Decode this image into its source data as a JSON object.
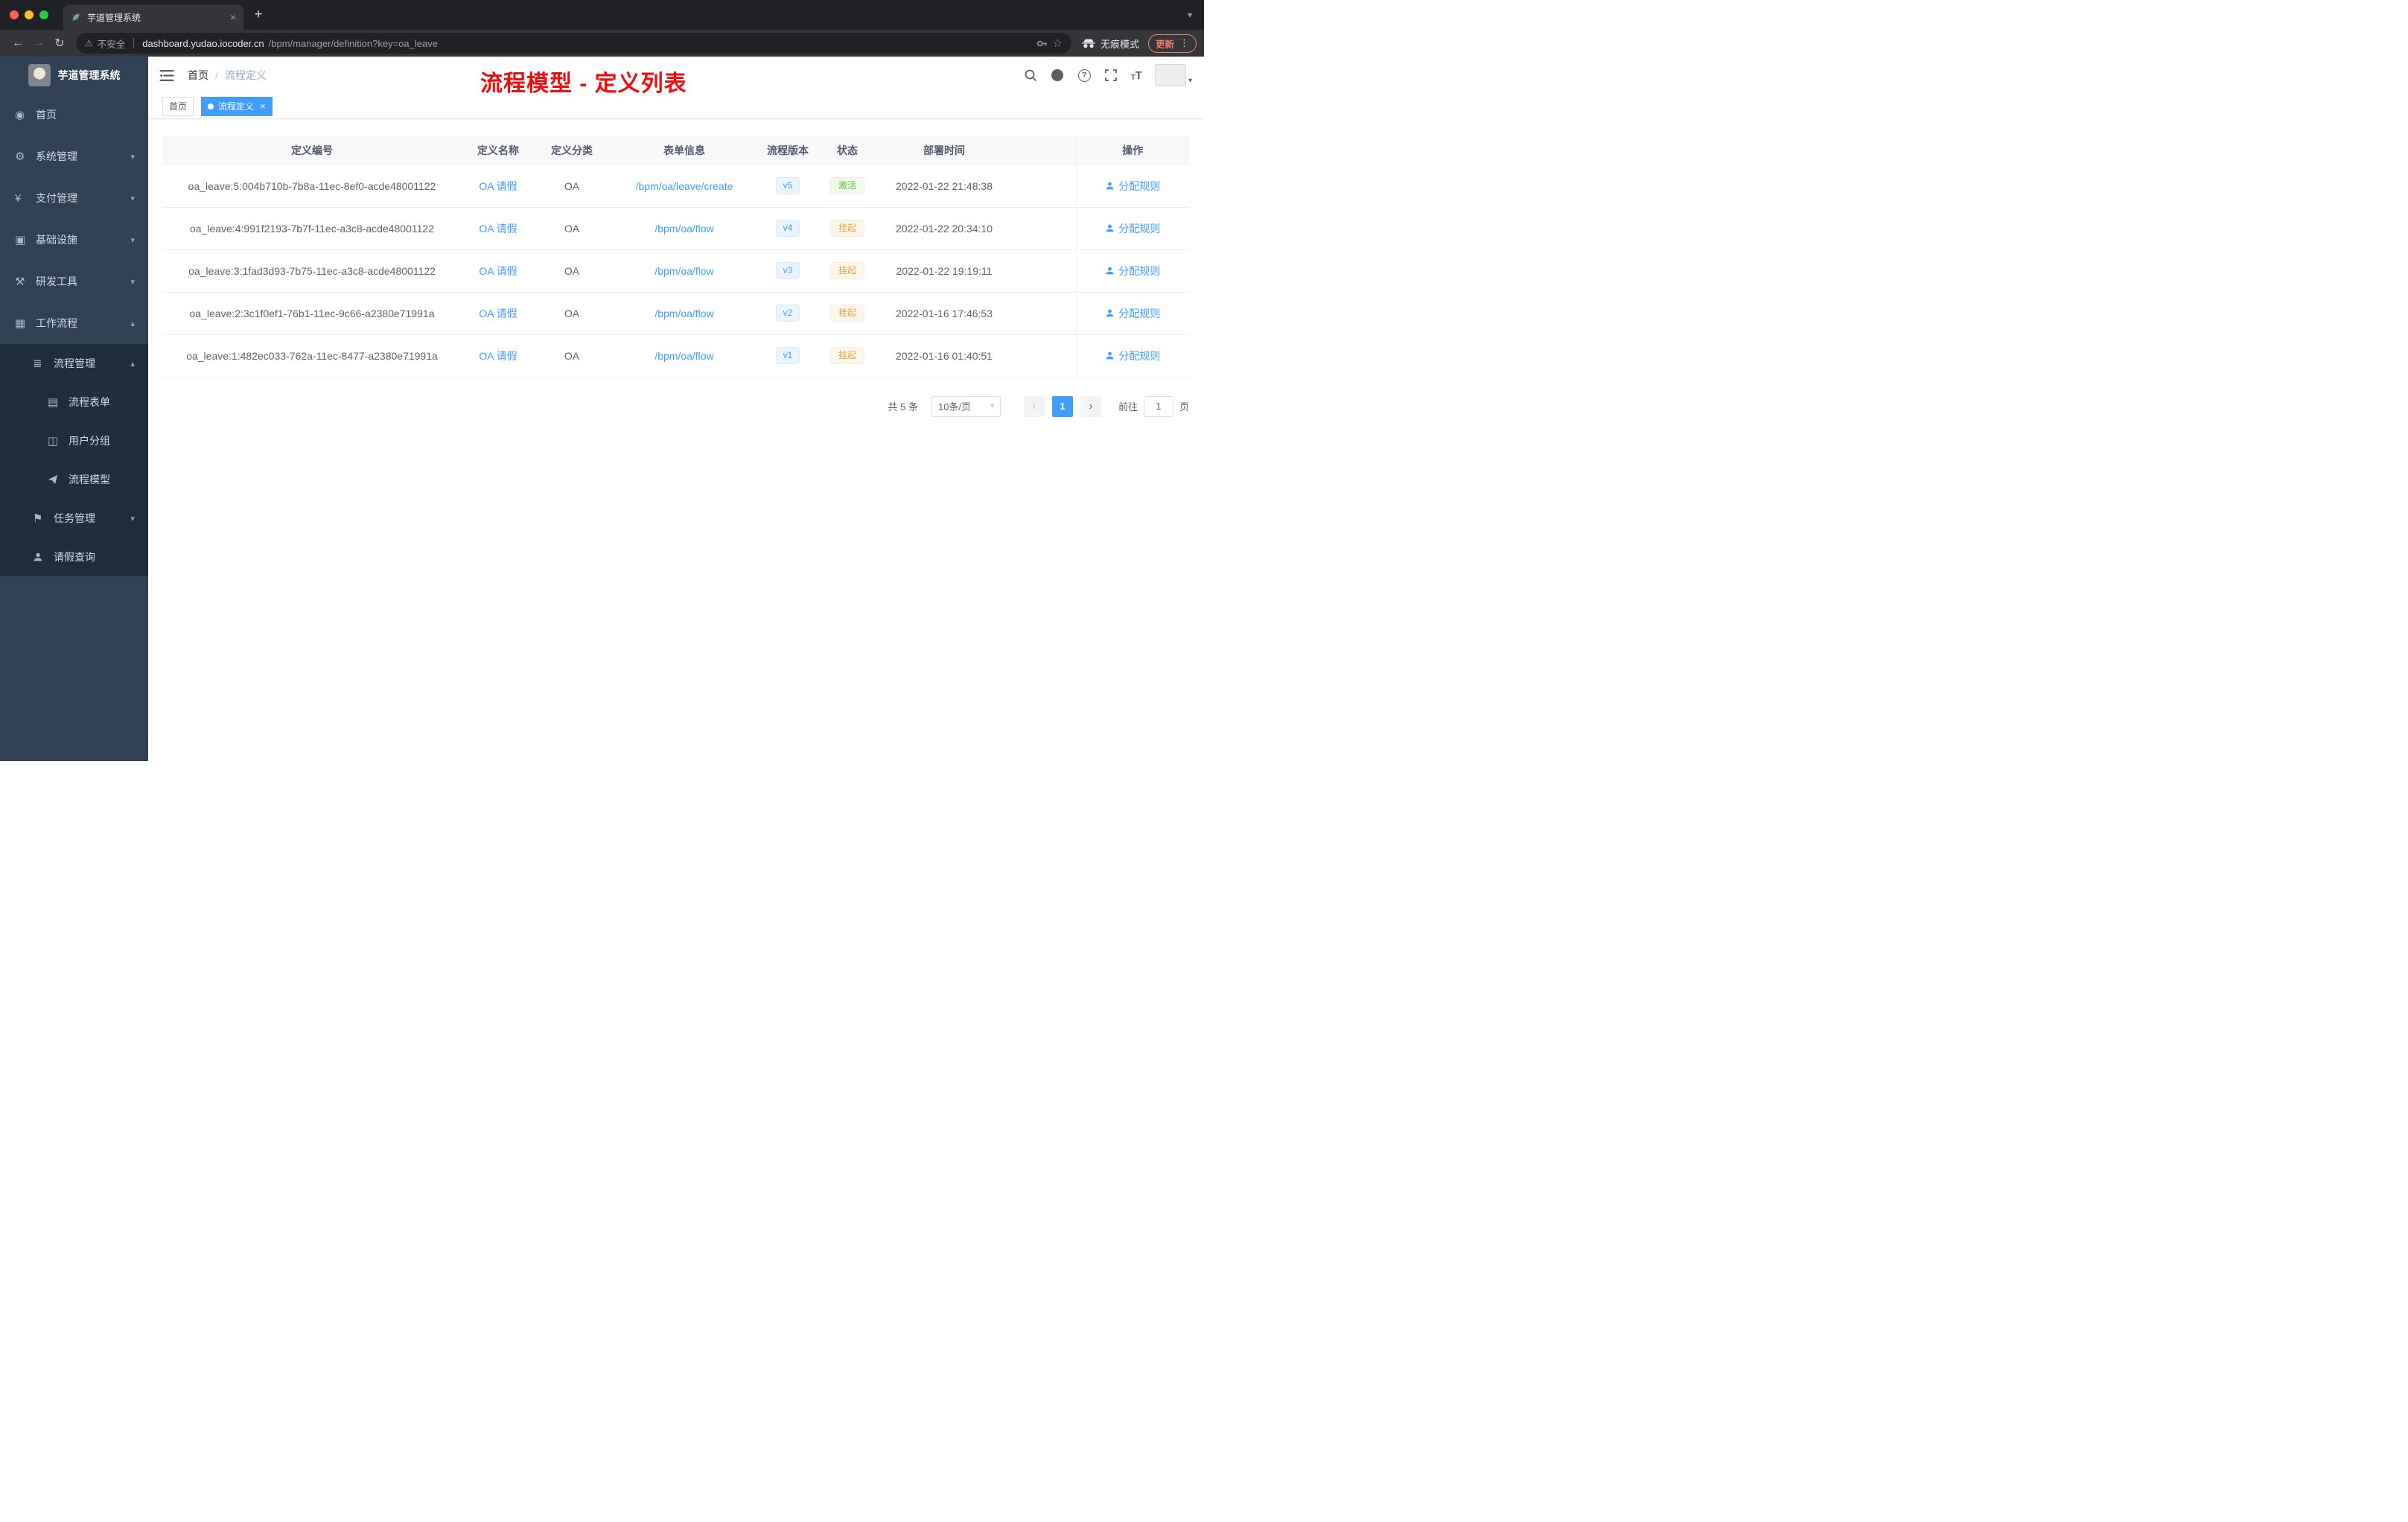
{
  "browser": {
    "tab_title": "芋道管理系统",
    "security_label": "不安全",
    "url_host": "dashboard.yudao.iocoder.cn",
    "url_path": "/bpm/manager/definition?key=oa_leave",
    "incognito_label": "无痕模式",
    "update_label": "更新"
  },
  "glyphs": {
    "close": "×",
    "plus": "+",
    "back": "←",
    "forward": "→",
    "reload": "↻",
    "warning": "⚠",
    "star": "☆",
    "dots_vertical": "⋮",
    "chevron_down": "▾",
    "chevron_up": "▴",
    "prev": "‹",
    "next": "›",
    "question": "?",
    "breadcrumb_separator": "/",
    "font_large": "T",
    "font_small": "T"
  },
  "sidebar": {
    "title": "芋道管理系统",
    "items": [
      {
        "label": "首页",
        "glyph": "◉"
      },
      {
        "label": "系统管理",
        "glyph": "⚙"
      },
      {
        "label": "支付管理",
        "glyph": "¥"
      },
      {
        "label": "基础设施",
        "glyph": "▣"
      },
      {
        "label": "研发工具",
        "glyph": "⚒"
      },
      {
        "label": "工作流程",
        "glyph": "▦"
      }
    ],
    "submenu": [
      {
        "label": "流程管理",
        "glyph": "≣"
      },
      {
        "label": "流程表单",
        "glyph": "▤"
      },
      {
        "label": "用户分组",
        "glyph": "◫"
      },
      {
        "label": "流程模型"
      },
      {
        "label": "任务管理",
        "glyph": "⚑"
      },
      {
        "label": "请假查询"
      }
    ]
  },
  "header": {
    "breadcrumb_home": "首页",
    "breadcrumb_current": "流程定义",
    "annotation": "流程模型 - 定义列表"
  },
  "tags": {
    "home": "首页",
    "active": "流程定义"
  },
  "table": {
    "columns": [
      "定义编号",
      "定义名称",
      "定义分类",
      "表单信息",
      "流程版本",
      "状态",
      "部署时间",
      "操作"
    ],
    "rows": [
      {
        "id": "oa_leave:5:004b710b-7b8a-11ec-8ef0-acde48001122",
        "name": "OA 请假",
        "category": "OA",
        "form": "/bpm/oa/leave/create",
        "version": "v5",
        "status": "激活",
        "status_type": "success",
        "deploy_time": "2022-01-22 21:48:38",
        "action": "分配规则"
      },
      {
        "id": "oa_leave:4:991f2193-7b7f-11ec-a3c8-acde48001122",
        "name": "OA 请假",
        "category": "OA",
        "form": "/bpm/oa/flow",
        "version": "v4",
        "status": "挂起",
        "status_type": "warning",
        "deploy_time": "2022-01-22 20:34:10",
        "action": "分配规则"
      },
      {
        "id": "oa_leave:3:1fad3d93-7b75-11ec-a3c8-acde48001122",
        "name": "OA 请假",
        "category": "OA",
        "form": "/bpm/oa/flow",
        "version": "v3",
        "status": "挂起",
        "status_type": "warning",
        "deploy_time": "2022-01-22 19:19:11",
        "action": "分配规则"
      },
      {
        "id": "oa_leave:2:3c1f0ef1-76b1-11ec-9c66-a2380e71991a",
        "name": "OA 请假",
        "category": "OA",
        "form": "/bpm/oa/flow",
        "version": "v2",
        "status": "挂起",
        "status_type": "warning",
        "deploy_time": "2022-01-16 17:46:53",
        "action": "分配规则"
      },
      {
        "id": "oa_leave:1:482ec033-762a-11ec-8477-a2380e71991a",
        "name": "OA 请假",
        "category": "OA",
        "form": "/bpm/oa/flow",
        "version": "v1",
        "status": "挂起",
        "status_type": "warning",
        "deploy_time": "2022-01-16 01:40:51",
        "action": "分配规则"
      }
    ]
  },
  "pagination": {
    "total": "共 5 条",
    "page_size": "10条/页",
    "current_page": "1",
    "goto_label": "前往",
    "goto_value": "1",
    "page_unit": "页"
  },
  "colors": {
    "accent": "#409eff",
    "sidebar_bg": "#304156",
    "submenu_bg": "#1f2d3d",
    "annotation_red": "#f20d0d",
    "success": "#67c23a",
    "warning": "#e6a23c",
    "chrome_bg": "#202124",
    "toolbar_bg": "#35363a"
  }
}
